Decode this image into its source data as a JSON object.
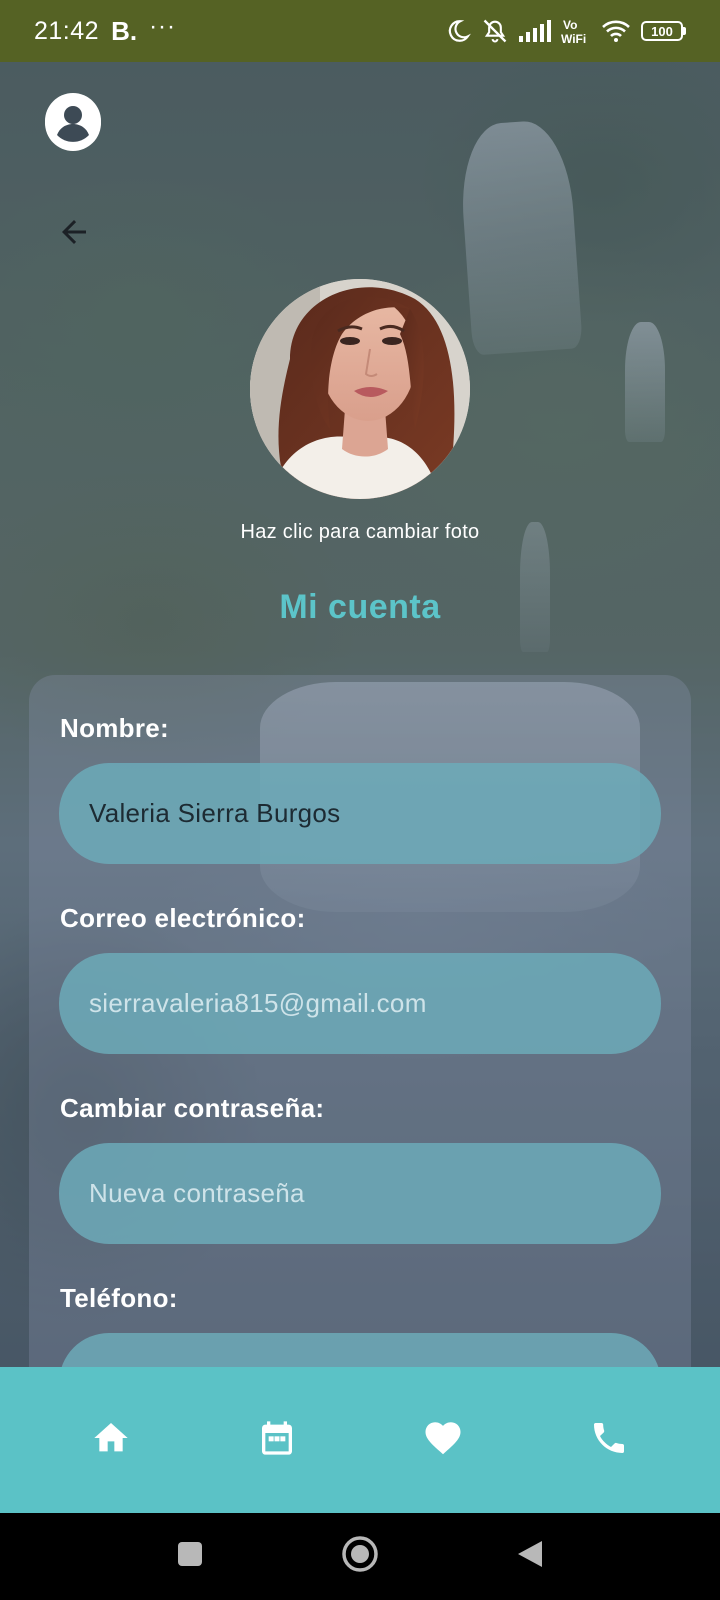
{
  "status_bar": {
    "time": "21:42",
    "app_indicator": "B.",
    "more_indicator": "···",
    "battery_level": "100",
    "icons": [
      "moon-icon",
      "mute-icon",
      "signal-icon",
      "vowifi-icon",
      "wifi-icon",
      "battery-icon"
    ]
  },
  "header": {
    "account_icon": "account-circle-icon",
    "back_icon": "arrow-back-icon"
  },
  "profile": {
    "photo_hint": "Haz clic para cambiar foto",
    "title": "Mi cuenta"
  },
  "form": {
    "name": {
      "label": "Nombre:",
      "value": "Valeria Sierra Burgos"
    },
    "email": {
      "label": "Correo electrónico:",
      "value": "sierravaleria815@gmail.com"
    },
    "password": {
      "label": "Cambiar contraseña:",
      "placeholder": "Nueva contraseña"
    },
    "phone": {
      "label": "Teléfono:",
      "value": ""
    }
  },
  "bottom_nav": {
    "items": [
      {
        "icon": "home-icon"
      },
      {
        "icon": "calendar-icon"
      },
      {
        "icon": "heart-icon"
      },
      {
        "icon": "phone-icon"
      }
    ]
  },
  "system_nav": {
    "buttons": [
      "recents-icon",
      "home-circle-icon",
      "back-triangle-icon"
    ]
  },
  "colors": {
    "status_bar_bg": "#556224",
    "accent_teal": "#5bc2c6",
    "title_teal": "#5cc4c9",
    "input_bg": "#6caab8"
  }
}
